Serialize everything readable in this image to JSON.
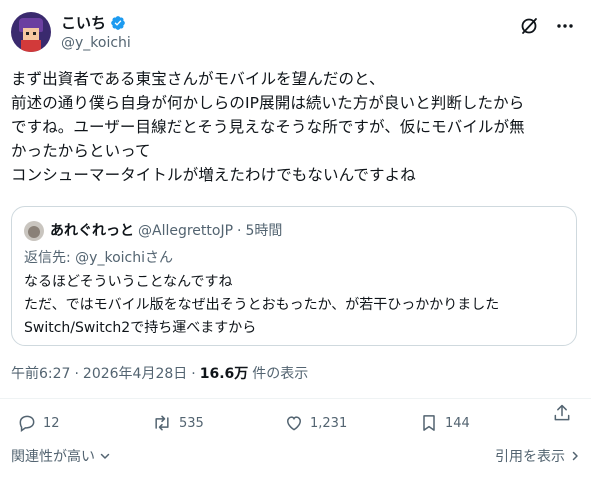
{
  "author": {
    "display_name": "こいち",
    "handle": "@y_koichi",
    "verified": true
  },
  "tweet": {
    "text": "まず出資者である東宝さんがモバイルを望んだのと、\n前述の通り僕ら自身が何かしらのIP展開は続いた方が良いと判断したから\nですね。ユーザー目線だとそう見えなそうな所ですが、仮にモバイルが無\nかったからといって\nコンシューマータイトルが増えたわけでもないんですよね"
  },
  "quote": {
    "display_name": "あれぐれっと",
    "handle": "@AllegrettoJP",
    "separator": "·",
    "time": "5時間",
    "reply_prefix": "返信先: ",
    "reply_mention": "@y_koichi",
    "reply_suffix": "さん",
    "text": "なるほどそういうことなんですね\nただ、ではモバイル版をなぜ出そうとおもったか、が若干ひっかかりました\nSwitch/Switch2で持ち運べますから"
  },
  "meta": {
    "time": "午前6:27",
    "separator1": "·",
    "date": "2026年4月28日",
    "separator2": "·",
    "views": "16.6万",
    "views_label": "件の表示"
  },
  "actions": {
    "replies": "12",
    "reposts": "535",
    "likes": "1,231",
    "bookmarks": "144"
  },
  "footer": {
    "sort_label": "関連性が高い",
    "quotes_label": "引用を表示"
  },
  "colors": {
    "text": "#0f1419",
    "muted": "#536471",
    "border": "#cfd9de",
    "verified": "#1d9bf0"
  },
  "icons": {
    "verified": "verified-badge-icon",
    "grok": "grok-icon",
    "more": "more-icon",
    "reply": "reply-icon",
    "repost": "repost-icon",
    "like": "like-icon",
    "bookmark": "bookmark-icon",
    "share": "share-icon",
    "chevron_down": "chevron-down-icon",
    "chevron_right": "chevron-right-icon"
  }
}
